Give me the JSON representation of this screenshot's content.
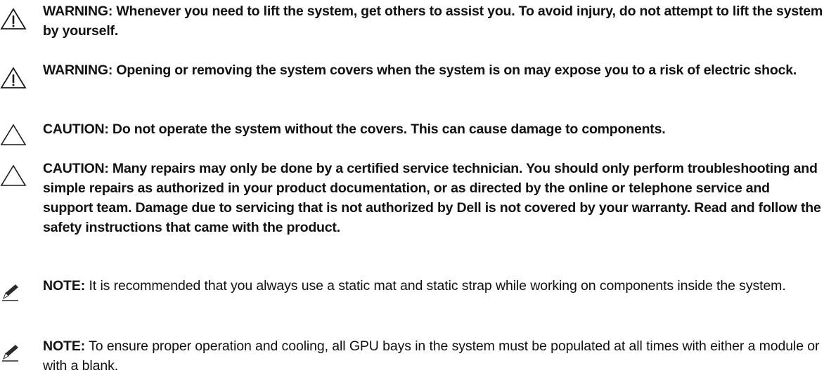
{
  "notices": [
    {
      "type": "warning",
      "icon": "warning-triangle-icon",
      "text": "WARNING: Whenever you need to lift the system, get others to assist you. To avoid injury, do not attempt to lift the system by yourself."
    },
    {
      "type": "warning",
      "icon": "warning-triangle-icon",
      "text": "WARNING: Opening or removing the system covers when the system is on may expose you to a risk of electric shock."
    },
    {
      "type": "caution",
      "icon": "caution-triangle-icon",
      "text": "CAUTION: Do not operate the system without the covers. This can cause damage to components."
    },
    {
      "type": "caution",
      "icon": "caution-triangle-icon",
      "text": "CAUTION: Many repairs may only be done by a certified service technician. You should only perform troubleshooting and simple repairs as authorized in your product documentation, or as directed by the online or telephone service and support team. Damage due to servicing that is not authorized by Dell is not covered by your warranty. Read and follow the safety instructions that came with the product."
    },
    {
      "type": "note",
      "icon": "pencil-note-icon",
      "label": "NOTE:",
      "text": " It is recommended that you always use a static mat and static strap while working on components inside the system."
    },
    {
      "type": "note",
      "icon": "pencil-note-icon",
      "label": "NOTE:",
      "text": " To ensure proper operation and cooling, all GPU bays in the system must be populated at all times with either a module or with a blank."
    }
  ]
}
